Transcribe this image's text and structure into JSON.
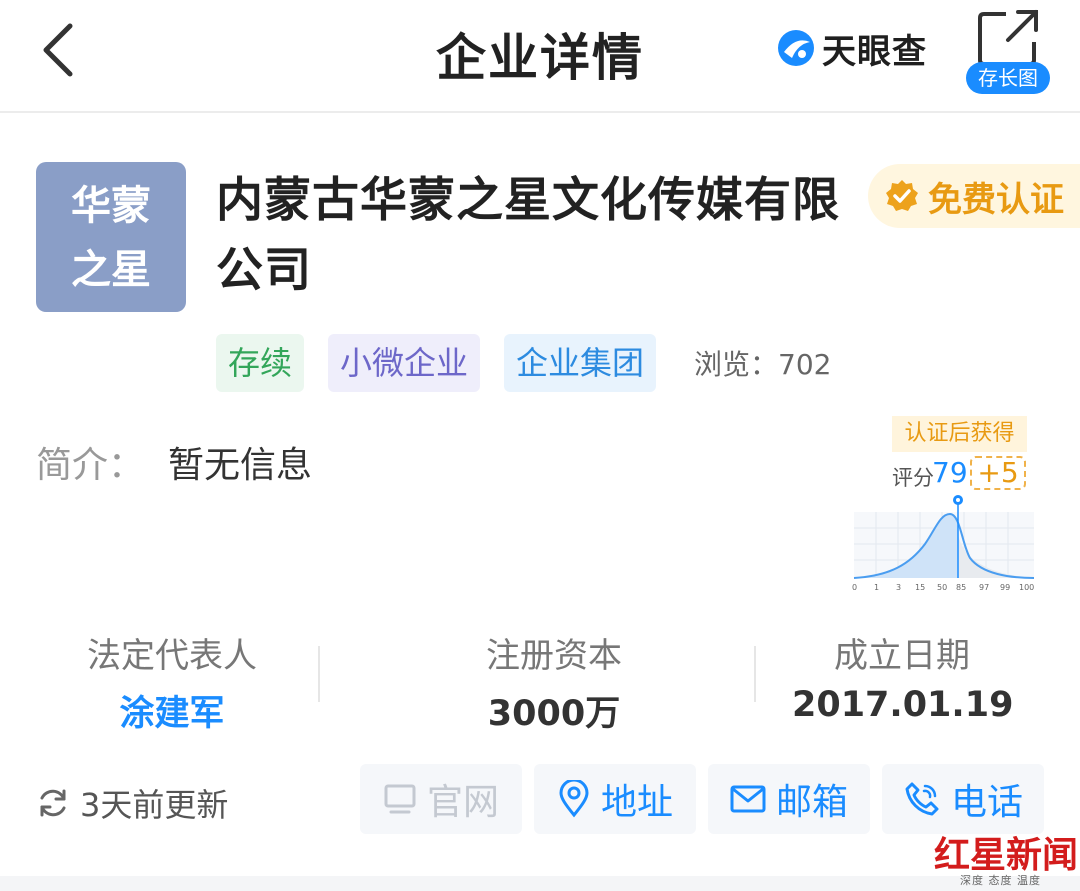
{
  "header": {
    "title": "企业详情",
    "brand": "天眼查",
    "share_label": "存长图"
  },
  "company": {
    "logo_line1": "华蒙",
    "logo_line2": "之星",
    "name": "内蒙古华蒙之星文化传媒有限公司",
    "verify_label": "免费认证",
    "tags": [
      "存续",
      "小微企业",
      "企业集团"
    ],
    "views": "浏览：702",
    "intro_key": "简介：",
    "intro_value": "暂无信息"
  },
  "score": {
    "tip": "认证后获得",
    "label": "评分",
    "value": "79",
    "bonus": "+5",
    "axis_ticks": [
      "0",
      "1",
      "3",
      "15",
      "50",
      "85",
      "97",
      "99",
      "100"
    ]
  },
  "info": {
    "legal_rep_key": "法定代表人",
    "legal_rep_value": "涂建军",
    "capital_key": "注册资本",
    "capital_value": "3000万",
    "founded_key": "成立日期",
    "founded_value": "2017.01.19"
  },
  "actions": {
    "update": "3天前更新",
    "website": "官网",
    "address": "地址",
    "email": "邮箱",
    "phone": "电话"
  },
  "watermark": {
    "title": "红星新闻",
    "sub": "深度 态度 温度"
  },
  "colors": {
    "accent": "#1a8cff",
    "verify": "#e89a12",
    "logo_bg": "#8a9ec7"
  }
}
